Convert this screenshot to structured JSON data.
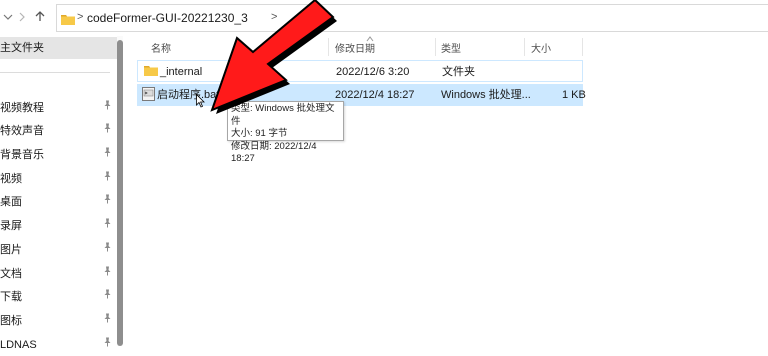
{
  "nav": {
    "back_icon": "chevron-down-icon",
    "forward_icon": "chevron-right-icon",
    "up_icon": "arrow-up-icon"
  },
  "address": {
    "path": "codeFormer-GUI-20221230_3",
    "sep1": ">",
    "sep2": ">"
  },
  "sidebar": {
    "items": [
      {
        "label": "主文件夹",
        "pinned": false
      },
      {
        "label": "视频教程",
        "pinned": true
      },
      {
        "label": "特效声音",
        "pinned": true
      },
      {
        "label": "背景音乐",
        "pinned": true
      },
      {
        "label": "视频",
        "pinned": true
      },
      {
        "label": "桌面",
        "pinned": true
      },
      {
        "label": "录屏",
        "pinned": true
      },
      {
        "label": "图片",
        "pinned": true
      },
      {
        "label": "文档",
        "pinned": true
      },
      {
        "label": "下载",
        "pinned": true
      },
      {
        "label": "图标",
        "pinned": true
      },
      {
        "label": "LDNAS",
        "pinned": true
      }
    ]
  },
  "columns": {
    "name": "名称",
    "modified": "修改日期",
    "type": "类型",
    "size": "大小"
  },
  "files": [
    {
      "name": "_internal",
      "modified": "2022/12/6 3:20",
      "type": "文件夹",
      "size": "",
      "icon": "folder-icon"
    },
    {
      "name": "启动程序.bat",
      "modified": "2022/12/4 18:27",
      "type": "Windows 批处理...",
      "size": "1 KB",
      "icon": "batch-file-icon"
    }
  ],
  "tooltip": {
    "type_line": "类型: Windows 批处理文件",
    "size_line": "大小: 91 字节",
    "date_line": "修改日期: 2022/12/4 18:27"
  },
  "colors": {
    "selection": "#cce8ff",
    "hover_border": "#cde8ff",
    "folder": "#f7c948",
    "annotation_arrow": "#ff1a1a"
  }
}
